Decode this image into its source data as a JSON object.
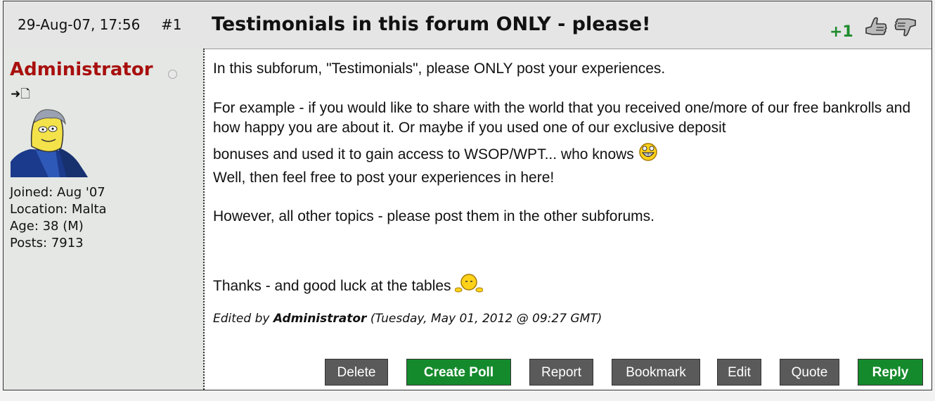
{
  "post": {
    "date": "29-Aug-07, 17:56",
    "number": "#1",
    "title": "Testimonials in this forum ONLY - please!",
    "reputation": "+1",
    "icons": {
      "vote_up": "thumbs-up-icon",
      "vote_down": "thumbs-down-icon"
    }
  },
  "author": {
    "name": "Administrator",
    "status_icon": "offline-status-icon",
    "profile_icons": "➜🗋",
    "avatar": "cartoon-avatar",
    "info": [
      "Joined: Aug '07",
      "Location: Malta",
      "Age: 38 (M)",
      "Posts: 7913"
    ]
  },
  "body": {
    "p1": "In this subforum, \"Testimonials\", please ONLY post your experiences.",
    "p2": "For example - if you would like to share with the world that you received one/more of our free bankrolls and how happy you are about it. Or maybe if you used one of our exclusive deposit",
    "p3": "bonuses and used it to gain access to WSOP/WPT... who knows",
    "p4": "Well, then feel free to post your experiences in here!",
    "p5": "However, all other topics - please post them in the other subforums.",
    "p6": "Thanks - and good luck at the tables",
    "edited_prefix": "Edited by",
    "edited_by": "Administrator",
    "edited_when": "(Tuesday, May 01, 2012 @ 09:27 GMT)"
  },
  "buttons": {
    "delete": "Delete",
    "create_poll": "Create Poll",
    "report": "Report",
    "bookmark": "Bookmark",
    "edit": "Edit",
    "quote": "Quote",
    "reply": "Reply"
  },
  "colors": {
    "username": "#a8100e",
    "reputation": "#1e8c2c",
    "primary_button": "#158a2d",
    "button": "#5a5a5a"
  }
}
